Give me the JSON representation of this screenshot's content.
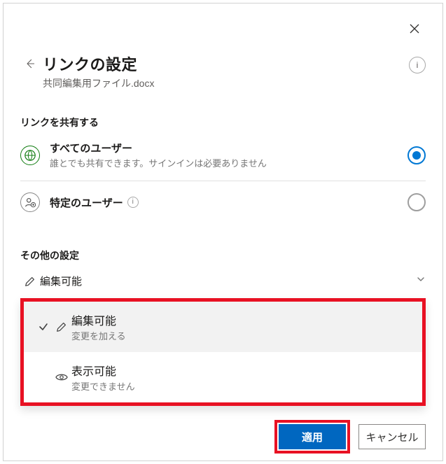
{
  "header": {
    "title": "リンクの設定",
    "subtitle": "共同編集用ファイル.docx"
  },
  "sections": {
    "share_label": "リンクを共有する",
    "other_label": "その他の設定"
  },
  "scope": {
    "anyone": {
      "title": "すべてのユーザー",
      "desc": "誰とでも共有できます。サインインは必要ありません"
    },
    "specific": {
      "title": "特定のユーザー"
    }
  },
  "permission": {
    "current": "編集可能",
    "options": {
      "edit": {
        "title": "編集可能",
        "desc": "変更を加える"
      },
      "view": {
        "title": "表示可能",
        "desc": "変更できません"
      }
    }
  },
  "footer": {
    "apply": "適用",
    "cancel": "キャンセル"
  }
}
